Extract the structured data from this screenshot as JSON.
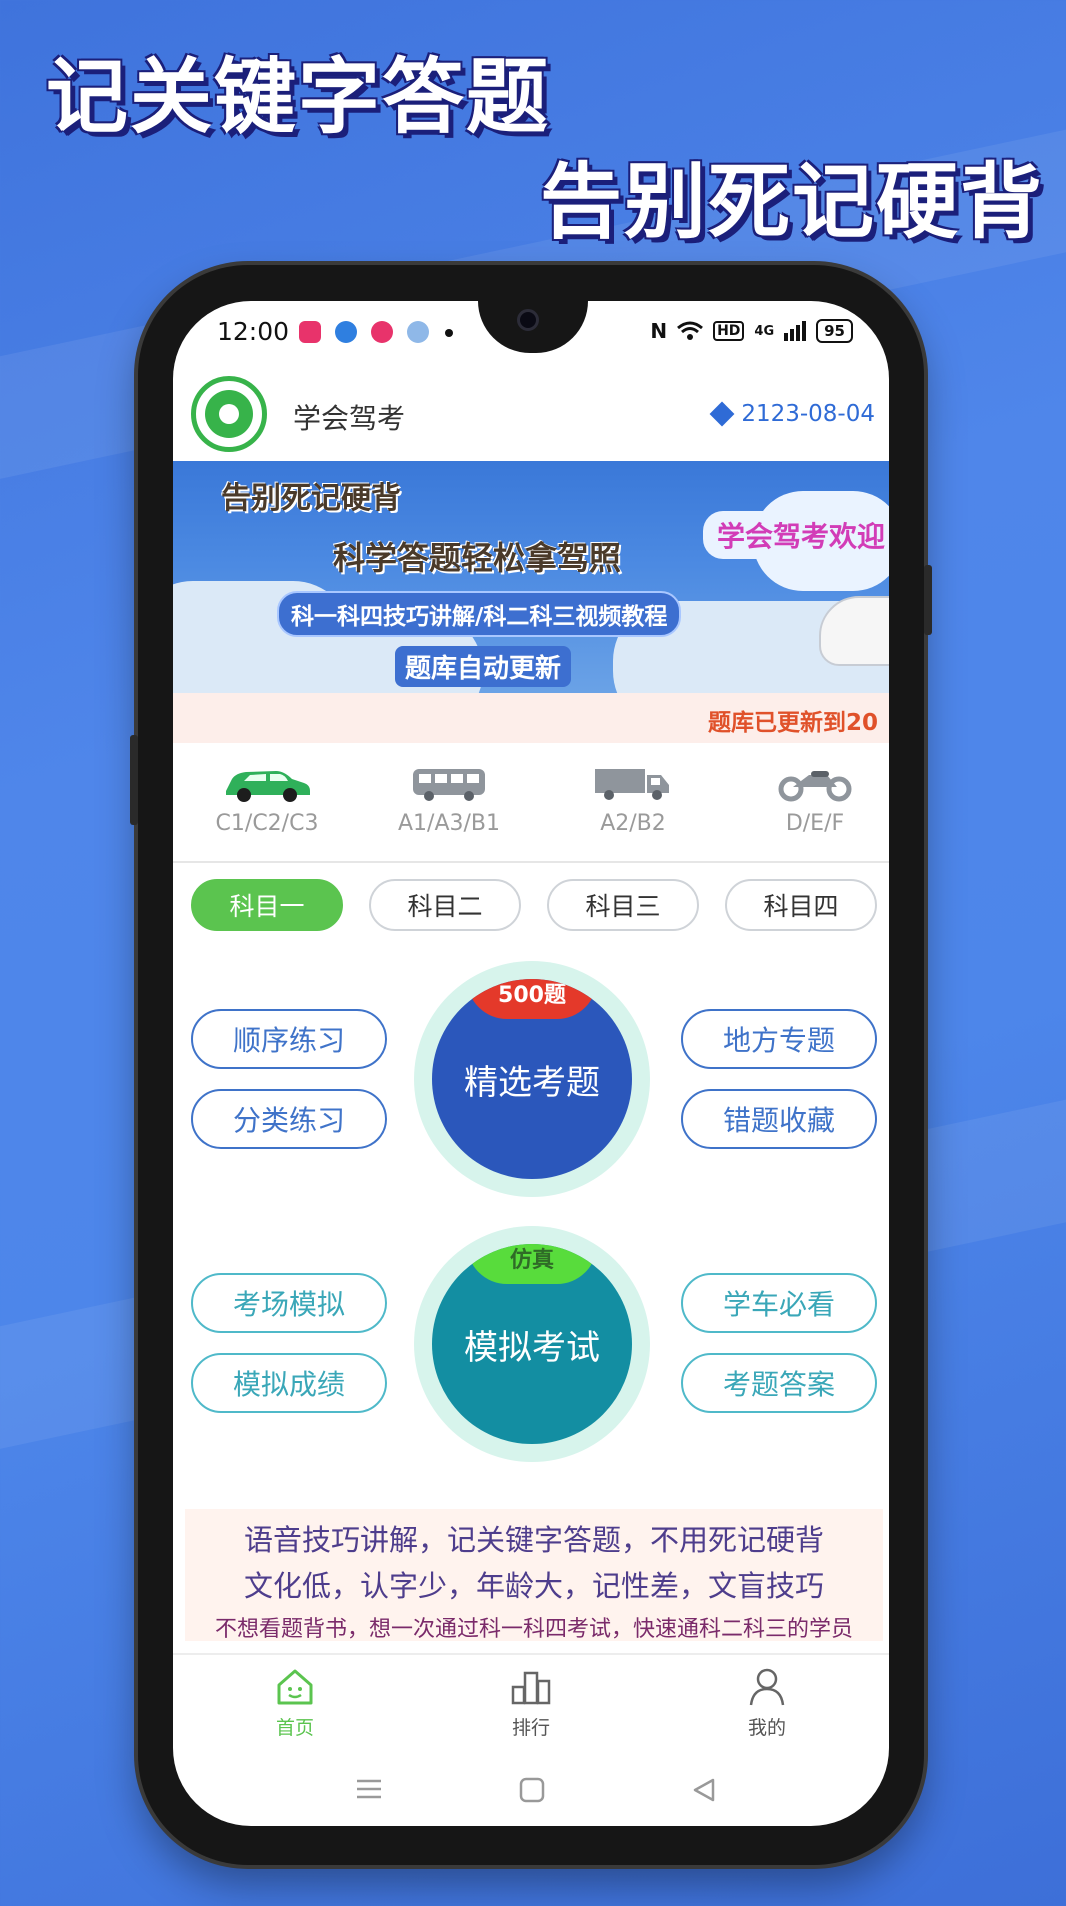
{
  "promo_headline": {
    "line1": "记关键字答题",
    "line2": "告别死记硬背"
  },
  "status_bar": {
    "time": "12:00",
    "network": "4G",
    "hd": "HD",
    "battery": "95"
  },
  "app_bar": {
    "app_name": "学会驾考",
    "vip_expiry": "2123-08-04"
  },
  "banner": {
    "line1": "告别死记硬背",
    "line2": "科学答题轻松拿驾照",
    "line3": "科一科四技巧讲解/科二科三视频教程",
    "line4": "题库自动更新",
    "welcome": "学会驾考欢迎"
  },
  "marquee": {
    "text": "题库已更新到20"
  },
  "vehicle_tabs": [
    {
      "label": "C1/C2/C3",
      "icon": "car-icon",
      "color": "#2fb05a"
    },
    {
      "label": "A1/A3/B1",
      "icon": "bus-icon",
      "color": "#8f959c"
    },
    {
      "label": "A2/B2",
      "icon": "truck-icon",
      "color": "#8f959c"
    },
    {
      "label": "D/E/F",
      "icon": "motorcycle-icon",
      "color": "#8f959c"
    }
  ],
  "subject_tabs": [
    {
      "label": "科目一",
      "active": true
    },
    {
      "label": "科目二",
      "active": false
    },
    {
      "label": "科目三",
      "active": false
    },
    {
      "label": "科目四",
      "active": false
    }
  ],
  "practice": {
    "left": [
      "顺序练习",
      "分类练习"
    ],
    "right": [
      "地方专题",
      "错题收藏"
    ],
    "center_label": "精选考题",
    "center_badge": "500题"
  },
  "exam": {
    "left": [
      "考场模拟",
      "模拟成绩"
    ],
    "right": [
      "学车必看",
      "考题答案"
    ],
    "center_label": "模拟考试",
    "center_badge": "仿真"
  },
  "promo_text": {
    "line1": "语音技巧讲解，记关键字答题，不用死记硬背",
    "line2": "文化低，认字少，年龄大，记性差，文盲技巧",
    "line3": "不想看题背书，想一次通过科一科四考试，快速通科二科三的学员"
  },
  "bottom_tabs": [
    {
      "label": "首页",
      "icon": "home-icon",
      "active": true
    },
    {
      "label": "排行",
      "icon": "ranking-icon",
      "active": false
    },
    {
      "label": "我的",
      "icon": "profile-icon",
      "active": false
    }
  ],
  "colors": {
    "accent_green": "#5bc44f",
    "primary_blue": "#2b57bb",
    "teal": "#138ea2",
    "background_blue": "#4f86ea"
  }
}
